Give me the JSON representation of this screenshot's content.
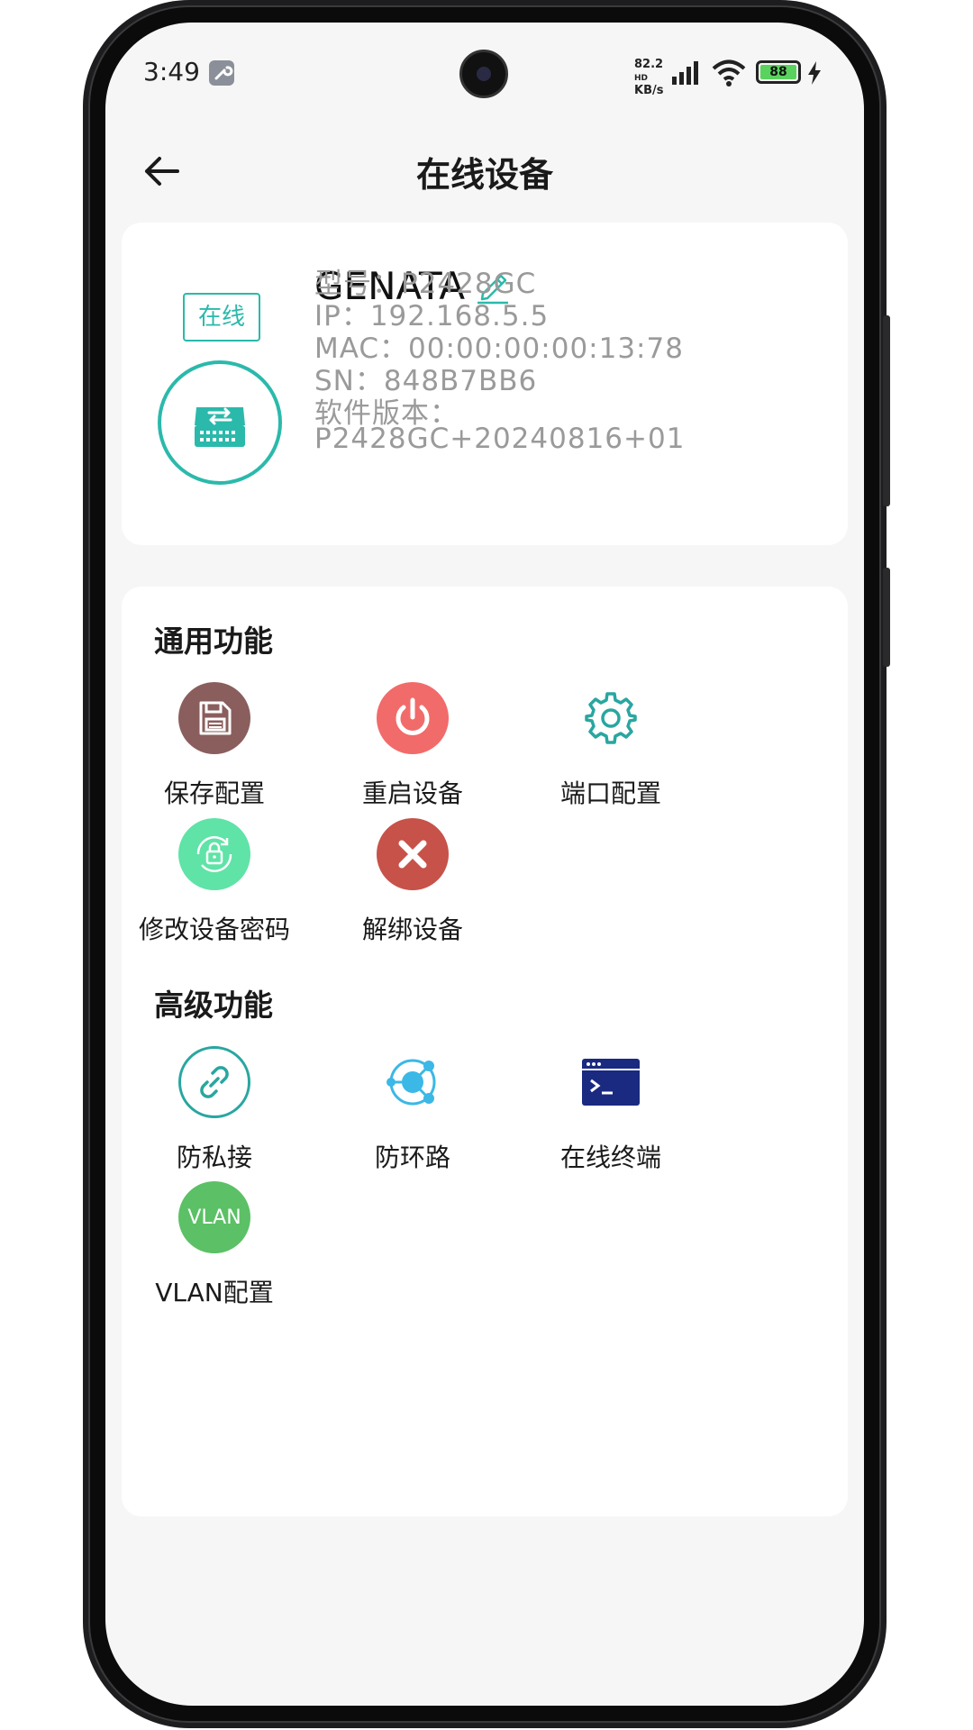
{
  "status_bar": {
    "time": "3:49",
    "net_speed_value": "82.2",
    "net_speed_unit": "KB/s",
    "network_type": "HD",
    "battery": "88"
  },
  "header": {
    "title": "在线设备"
  },
  "device": {
    "status_badge": "在线",
    "name": "GENATA",
    "model": "型号：P2428GC",
    "ip": "IP：192.168.5.5",
    "mac": "MAC：00:00:00:00:13:78",
    "sn": "SN：848B7BB6",
    "firmware_label": "软件版本：",
    "firmware_value": "P2428GC+20240816+01"
  },
  "general": {
    "title": "通用功能",
    "items": [
      {
        "label": "保存配置",
        "icon": "save-icon",
        "color": "#8b5e5e"
      },
      {
        "label": "重启设备",
        "icon": "power-icon",
        "color": "#f26b6b"
      },
      {
        "label": "端口配置",
        "icon": "gear-icon",
        "color": "#2aa6a0"
      },
      {
        "label": "修改设备密码",
        "icon": "lock-refresh-icon",
        "color": "#5fe3a6"
      },
      {
        "label": "解绑设备",
        "icon": "close-icon",
        "color": "#c6524a"
      }
    ]
  },
  "advanced": {
    "title": "高级功能",
    "items": [
      {
        "label": "防私接",
        "icon": "link-icon",
        "color": "#2aa6a0"
      },
      {
        "label": "防环路",
        "icon": "loop-icon",
        "color": "#3bb8e6"
      },
      {
        "label": "在线终端",
        "icon": "terminal-icon",
        "color": "#1a2a80"
      },
      {
        "label": "VLAN配置",
        "icon": "vlan-icon",
        "color": "#5cc066",
        "icon_text": "VLAN"
      }
    ]
  }
}
